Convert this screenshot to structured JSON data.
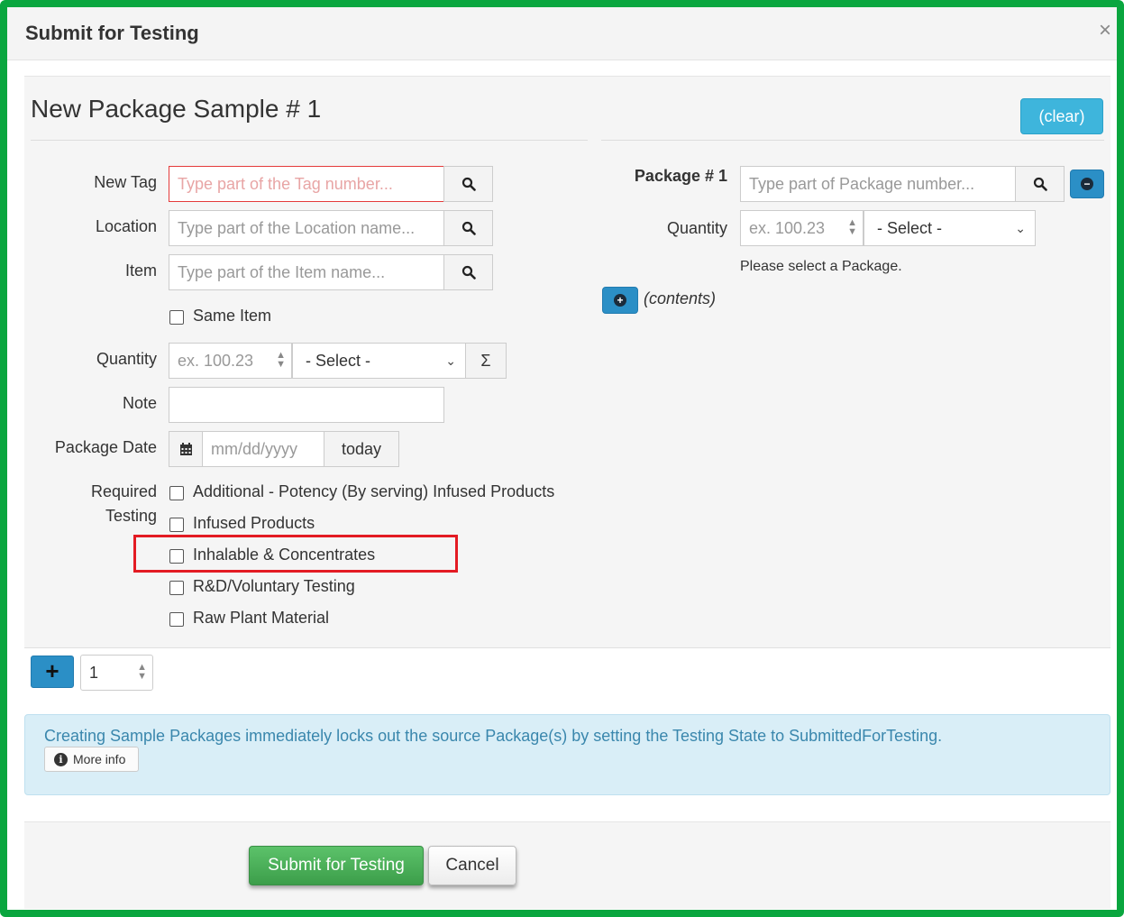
{
  "modal": {
    "title": "Submit for Testing",
    "close_glyph": "×"
  },
  "sample": {
    "title": "New Package Sample # 1",
    "clear_label": "(clear)",
    "new_tag": {
      "label": "New Tag",
      "placeholder": "Type part of the Tag number..."
    },
    "location": {
      "label": "Location",
      "placeholder": "Type part of the Location name..."
    },
    "item": {
      "label": "Item",
      "placeholder": "Type part of the Item name..."
    },
    "same_item_label": "Same Item",
    "quantity": {
      "label": "Quantity",
      "placeholder": "ex. 100.23",
      "unit_selected": "- Select -",
      "sum_glyph": "Σ"
    },
    "note": {
      "label": "Note",
      "value": ""
    },
    "package_date": {
      "label": "Package Date",
      "placeholder": "mm/dd/yyyy",
      "today_label": "today"
    },
    "required_testing": {
      "label_line1": "Required",
      "label_line2": "Testing",
      "options": [
        "Additional - Potency (By serving) Infused Products",
        "Infused Products",
        "Inhalable & Concentrates",
        "R&D/Voluntary Testing",
        "Raw Plant Material"
      ]
    }
  },
  "package": {
    "label": "Package # 1",
    "placeholder": "Type part of Package number...",
    "quantity_label": "Quantity",
    "quantity_placeholder": "ex. 100.23",
    "unit_selected": "- Select -",
    "hint": "Please select a Package.",
    "contents_label": "(contents)"
  },
  "add_row": {
    "count_value": "1"
  },
  "alert": {
    "message": "Creating Sample Packages immediately locks out the source Package(s) by setting the Testing State to SubmittedForTesting.",
    "more_info_label": "More info"
  },
  "footer": {
    "submit_label": "Submit for Testing",
    "cancel_label": "Cancel"
  },
  "colors": {
    "frame_green": "#0aa63f",
    "highlight_red": "#e31b23",
    "info_blue": "#3eb5dc",
    "submit_green": "#4cae59"
  }
}
